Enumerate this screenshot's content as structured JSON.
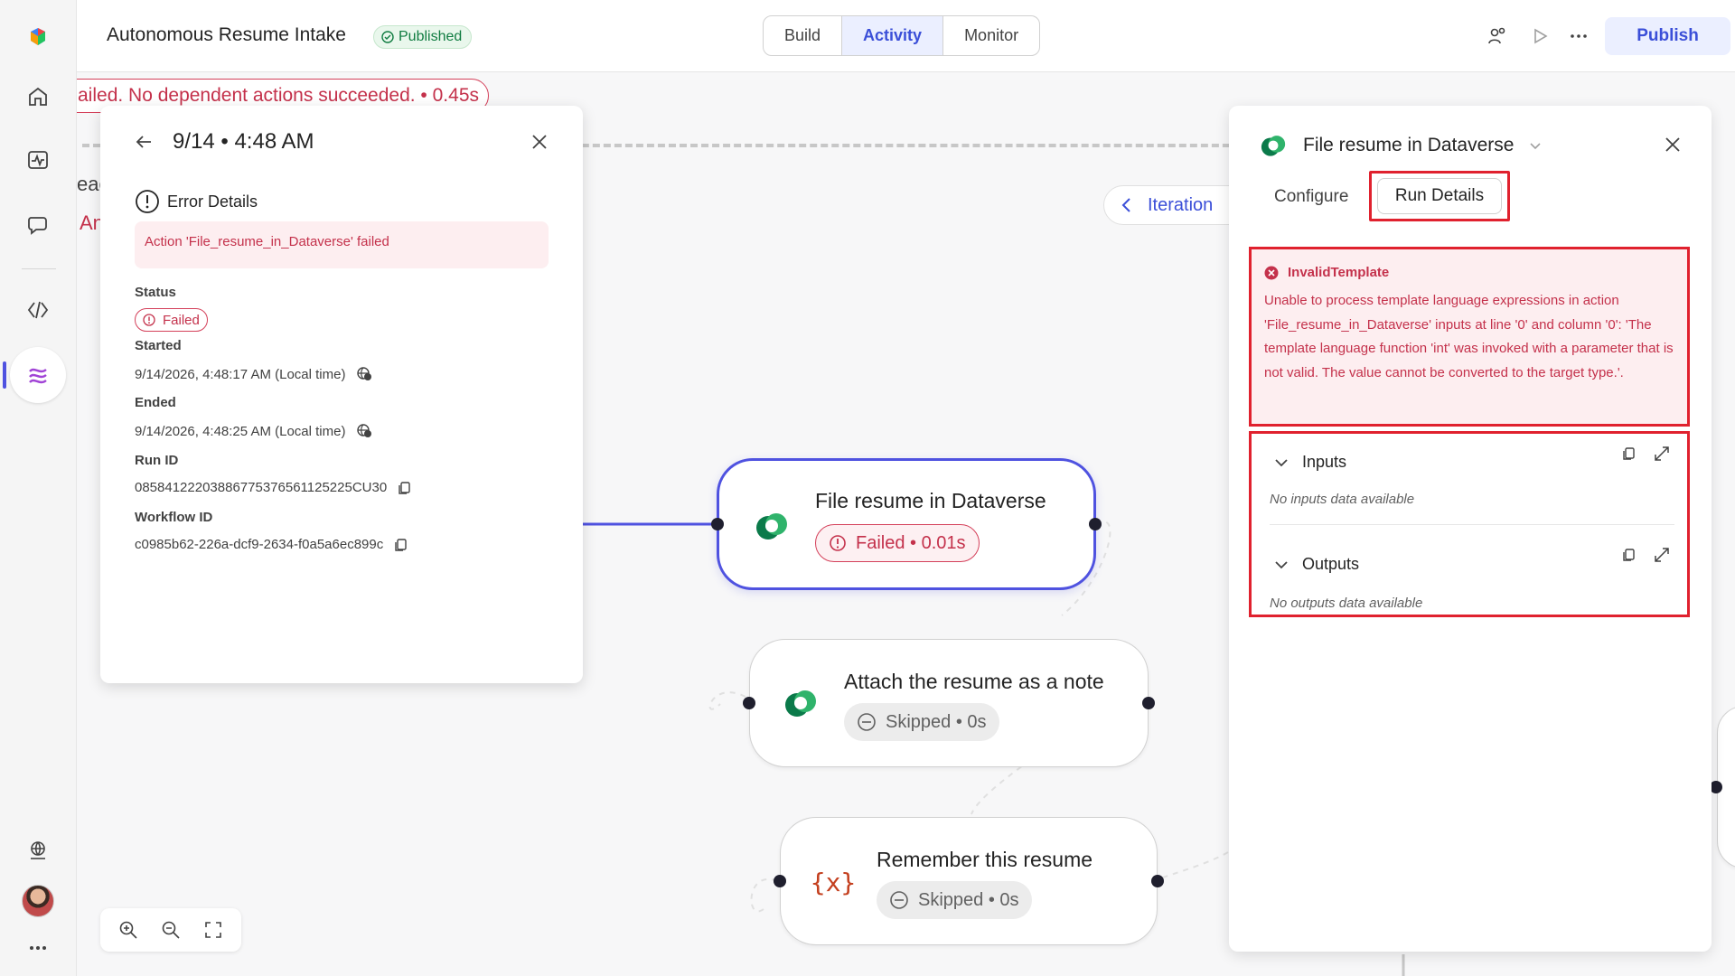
{
  "app": {
    "title": "Autonomous Resume Intake",
    "status": "Published",
    "tabs": [
      "Build",
      "Activity",
      "Monitor"
    ],
    "active_tab": "Activity",
    "publish_label": "Publish"
  },
  "canvas": {
    "banner": "ailed. No dependent actions succeeded. • 0.45s",
    "iteration_label": "Iteration",
    "ghost_text_1": "eac",
    "ghost_text_2": "An",
    "nodes": [
      {
        "title": "File resume in Dataverse",
        "status": "Failed • 0.01s",
        "state": "failed"
      },
      {
        "title": "Attach the resume as a note",
        "status": "Skipped • 0s",
        "state": "skipped"
      },
      {
        "title": "Remember this resume",
        "status": "Skipped • 0s",
        "state": "skipped"
      }
    ],
    "variable_icon_text": "{x}"
  },
  "run_panel": {
    "title": "9/14 • 4:48 AM",
    "error_details_label": "Error Details",
    "error_message": "Action 'File_resume_in_Dataverse' failed",
    "status_label": "Status",
    "status_value": "Failed",
    "started_label": "Started",
    "started_value": "9/14/2026, 4:48:17 AM (Local time)",
    "ended_label": "Ended",
    "ended_value": "9/14/2026, 4:48:25 AM (Local time)",
    "run_id_label": "Run ID",
    "run_id_value": "08584122203886775376561125225CU30",
    "workflow_id_label": "Workflow ID",
    "workflow_id_value": "c0985b62-226a-dcf9-2634-f0a5a6ec899c"
  },
  "detail_panel": {
    "title": "File resume in Dataverse",
    "tab_configure": "Configure",
    "tab_run_details": "Run Details",
    "error_code": "InvalidTemplate",
    "error_text": "Unable to process template language expressions in action 'File_resume_in_Dataverse' inputs at line '0' and column '0': 'The template language function 'int' was invoked with a parameter that is not valid. The value cannot be converted to the target type.'.",
    "inputs_label": "Inputs",
    "inputs_empty": "No inputs data available",
    "outputs_label": "Outputs",
    "outputs_empty": "No outputs data available"
  },
  "colors": {
    "accent": "#3b4fd8",
    "error": "#c4314b",
    "highlight_box": "#e0212e",
    "published": "#107c41"
  }
}
